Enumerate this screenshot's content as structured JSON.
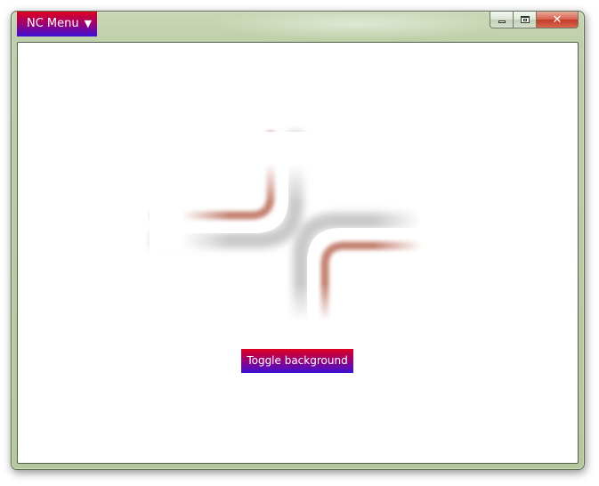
{
  "window": {
    "caption_buttons": {
      "minimize_icon": "minimize-icon",
      "maximize_icon": "maximize-icon",
      "close_icon": "close-icon",
      "close_glyph": "✕"
    }
  },
  "nc_menu": {
    "label": "NC Menu",
    "caret": "▼",
    "caret_icon": "triangle-down-icon"
  },
  "content": {
    "toggle_label": "Toggle background",
    "graphic": "cross-corners-graphic"
  },
  "colors": {
    "menu_gradient_top": "#e0001c",
    "menu_gradient_bottom": "#3d10d8",
    "frame": "#bfcfa9",
    "corner_shadow": "#c86e5a",
    "close_button": "#c23a24"
  }
}
